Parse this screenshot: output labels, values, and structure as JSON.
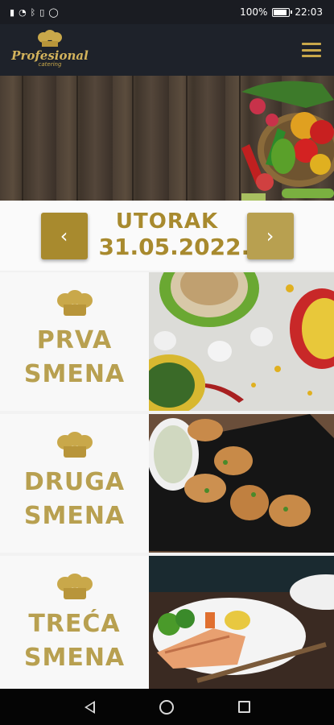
{
  "status_bar": {
    "left_icons": [
      "sim-card-icon",
      "wifi-icon",
      "bluetooth-icon",
      "vibrate-icon",
      "whatsapp-icon"
    ],
    "battery": "100%",
    "time": "22:03"
  },
  "app_bar": {
    "logo_title": "Profesional",
    "logo_subtitle": "catering"
  },
  "date_nav": {
    "day": "UTORAK",
    "date": "31.05.2022.",
    "prev_icon": "‹",
    "next_icon": "›"
  },
  "shifts": [
    {
      "line1": "PRVA",
      "line2": "SMENA"
    },
    {
      "line1": "DRUGA",
      "line2": "SMENA"
    },
    {
      "line1": "TREĆA",
      "line2": "SMENA"
    }
  ],
  "colors": {
    "gold": "#a88a2e",
    "gold_light": "#b8a050",
    "app_bar": "#1e222a"
  }
}
